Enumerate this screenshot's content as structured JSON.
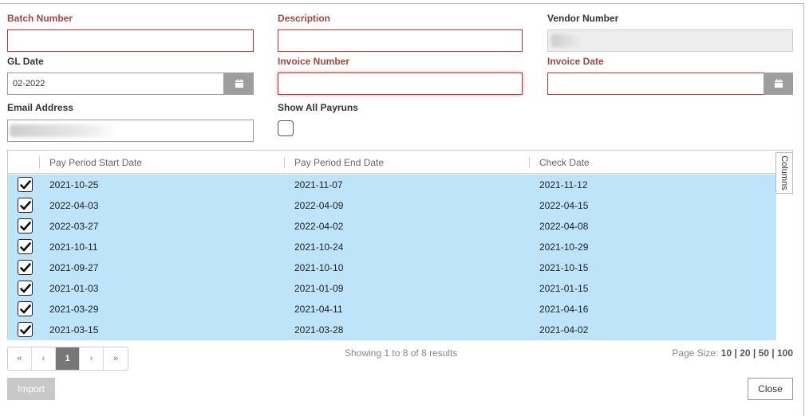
{
  "form": {
    "batch_number": {
      "label": "Batch Number",
      "value": ""
    },
    "description": {
      "label": "Description",
      "value": ""
    },
    "vendor_number": {
      "label": "Vendor Number",
      "value": ""
    },
    "gl_date": {
      "label": "GL Date",
      "value": "02-2022"
    },
    "invoice_number": {
      "label": "Invoice Number",
      "value": ""
    },
    "invoice_date": {
      "label": "Invoice Date",
      "value": ""
    },
    "email_address": {
      "label": "Email Address",
      "value": ""
    },
    "show_all_payruns": {
      "label": "Show All Payruns",
      "checked": false
    }
  },
  "grid": {
    "columns_button": "Columns",
    "headers": [
      "Pay Period Start Date",
      "Pay Period End Date",
      "Check Date"
    ],
    "rows": [
      {
        "start": "2021-10-25",
        "end": "2021-11-07",
        "check": "2021-11-12",
        "selected": true
      },
      {
        "start": "2022-04-03",
        "end": "2022-04-09",
        "check": "2022-04-15",
        "selected": true
      },
      {
        "start": "2022-03-27",
        "end": "2022-04-02",
        "check": "2022-04-08",
        "selected": true
      },
      {
        "start": "2021-10-11",
        "end": "2021-10-24",
        "check": "2021-10-29",
        "selected": true
      },
      {
        "start": "2021-09-27",
        "end": "2021-10-10",
        "check": "2021-10-15",
        "selected": true
      },
      {
        "start": "2021-01-03",
        "end": "2021-01-09",
        "check": "2021-01-15",
        "selected": true
      },
      {
        "start": "2021-03-29",
        "end": "2021-04-11",
        "check": "2021-04-16",
        "selected": true
      },
      {
        "start": "2021-03-15",
        "end": "2021-03-28",
        "check": "2021-04-02",
        "selected": true
      }
    ]
  },
  "pager": {
    "first": "«",
    "prev": "‹",
    "current": "1",
    "next": "›",
    "last": "»",
    "summary": "Showing 1 to 8 of 8 results",
    "page_size_label": "Page Size:",
    "sizes": [
      "10",
      "20",
      "50",
      "100"
    ]
  },
  "actions": {
    "import": "Import",
    "close": "Close"
  },
  "colors": {
    "required_label": "#a94442",
    "row_selected": "#bde4f8",
    "button_grey": "#9e9e9e"
  }
}
